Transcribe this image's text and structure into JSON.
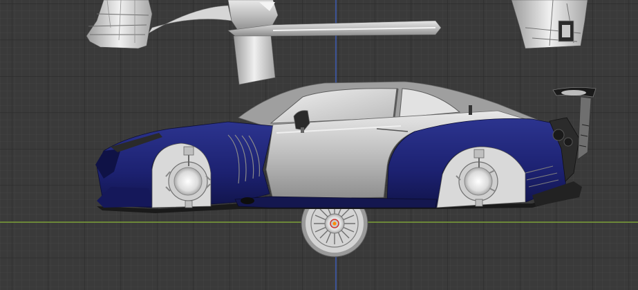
{
  "viewport": {
    "view": "right-orthographic",
    "grid": true,
    "colors": {
      "background": "#3a3a3a",
      "grid_minor": "#444444",
      "grid_major": "#2b2b2b",
      "axis_vertical": "#3f5fbf",
      "axis_horizontal": "#7fa33a",
      "origin": "#ff8a00"
    }
  },
  "model": {
    "colors": {
      "body_blue": "#1b1f6e",
      "body_blue_light": "#2e3590",
      "body_silver": "#c9c9c9",
      "body_silver_dark": "#8a8a8a",
      "glass": "#d8d8d8",
      "tire": "#1c1c1c",
      "trim_dark": "#2a2a2a"
    },
    "parts": [
      "car-body",
      "front-wheel-well",
      "rear-wheel-well",
      "spoiler",
      "detached-wheel",
      "detached-panels"
    ]
  }
}
